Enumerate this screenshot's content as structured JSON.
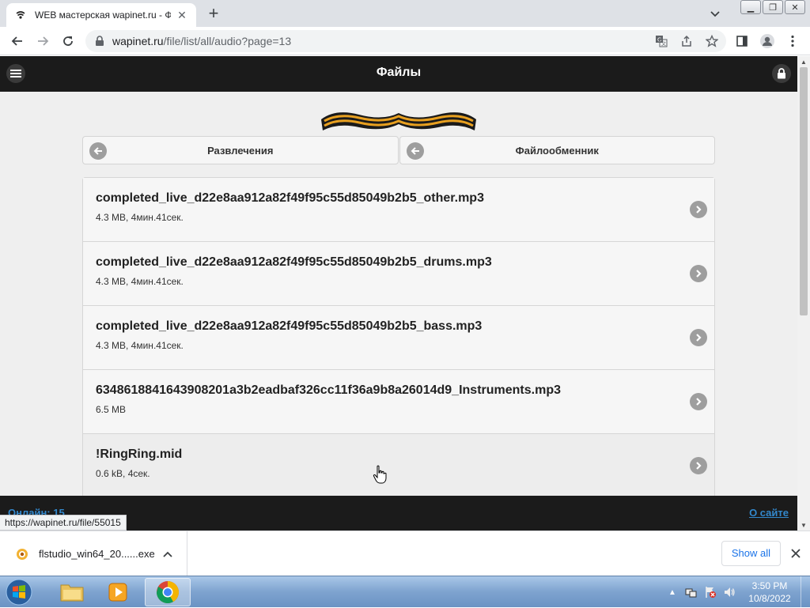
{
  "browser": {
    "tab_title": "WEB мастерская wapinet.ru - Фа",
    "url_host": "wapinet.ru",
    "url_path": "/file/list/all/audio?page=13",
    "status_url": "https://wapinet.ru/file/55015"
  },
  "page": {
    "title": "Файлы",
    "crumbs": [
      {
        "label": "Развлечения"
      },
      {
        "label": "Файлообменник"
      }
    ],
    "files": [
      {
        "name": "completed_live_d22e8aa912a82f49f95c55d85049b2b5_other.mp3",
        "meta": "4.3 MB, 4мин.41сек."
      },
      {
        "name": "completed_live_d22e8aa912a82f49f95c55d85049b2b5_drums.mp3",
        "meta": "4.3 MB, 4мин.41сек."
      },
      {
        "name": "completed_live_d22e8aa912a82f49f95c55d85049b2b5_bass.mp3",
        "meta": "4.3 MB, 4мин.41сек."
      },
      {
        "name": "6348618841643908201a3b2eadbaf326cc11f36a9b8a26014d9_Instruments.mp3",
        "meta": "6.5 MB"
      },
      {
        "name": "!RingRing.mid",
        "meta": "0.6 kB, 4сек."
      }
    ],
    "footer": {
      "online": "Онлайн: 15",
      "about": "О сайте"
    }
  },
  "downloads": {
    "file_name": "flstudio_win64_20......exe",
    "show_all": "Show all"
  },
  "taskbar": {
    "time": "3:50 PM",
    "date": "10/8/2022"
  },
  "colors": {
    "header_bg": "#1b1b1b",
    "link": "#3388cc",
    "list_bg": "#f6f6f6"
  }
}
